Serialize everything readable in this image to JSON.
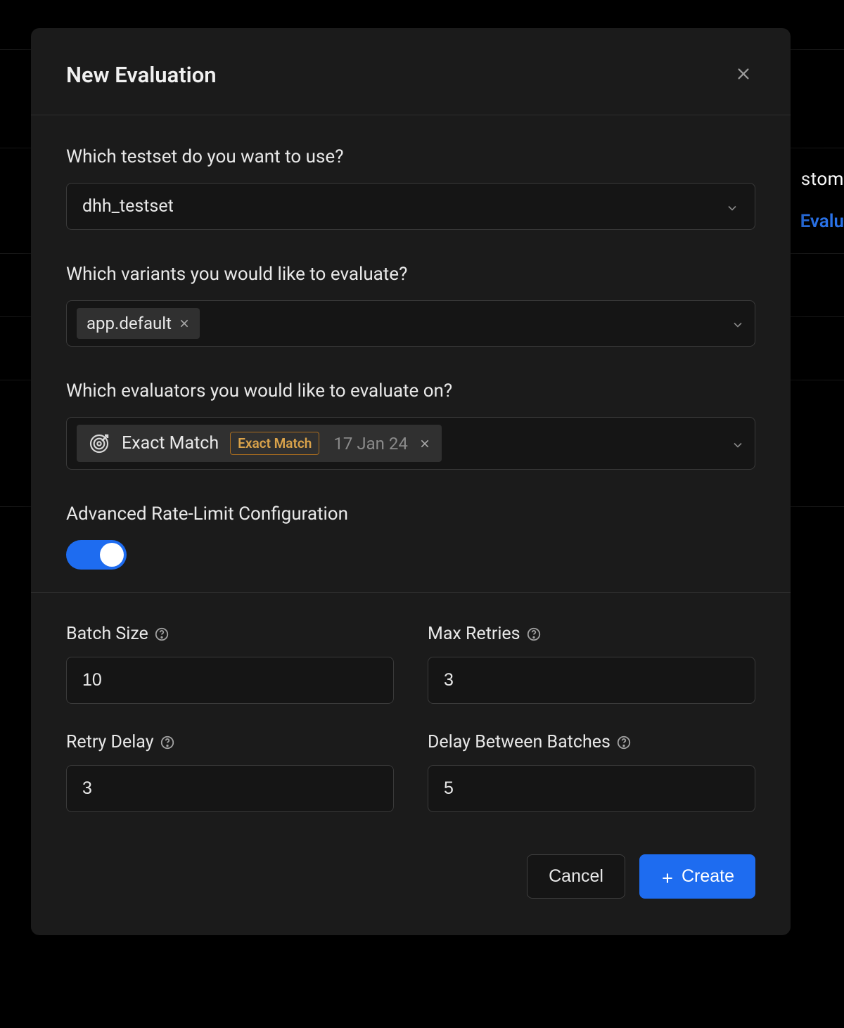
{
  "background": {
    "partial1": "stom",
    "partial2": "Evalu"
  },
  "modal": {
    "title": "New Evaluation",
    "testset": {
      "label": "Which testset do you want to use?",
      "value": "dhh_testset"
    },
    "variants": {
      "label": "Which variants you would like to evaluate?",
      "chips": [
        {
          "label": "app.default"
        }
      ]
    },
    "evaluators": {
      "label": "Which evaluators you would like to evaluate on?",
      "items": [
        {
          "name": "Exact Match",
          "badge": "Exact Match",
          "date": "17 Jan 24"
        }
      ]
    },
    "advanced": {
      "title": "Advanced Rate-Limit Configuration",
      "enabled": true
    },
    "config": {
      "batch_size": {
        "label": "Batch Size",
        "value": "10"
      },
      "max_retries": {
        "label": "Max Retries",
        "value": "3"
      },
      "retry_delay": {
        "label": "Retry Delay",
        "value": "3"
      },
      "delay_between_batches": {
        "label": "Delay Between Batches",
        "value": "5"
      }
    },
    "footer": {
      "cancel": "Cancel",
      "create": "Create"
    }
  }
}
